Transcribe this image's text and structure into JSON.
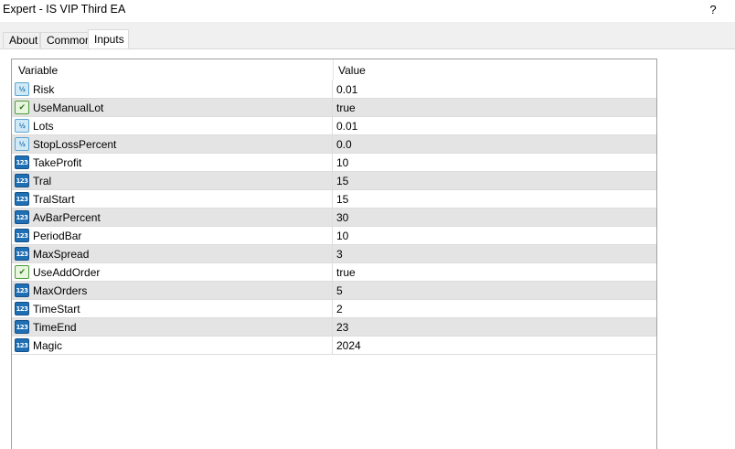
{
  "window": {
    "title": "Expert - IS VIP Third EA",
    "help_label": "?"
  },
  "tabs": [
    {
      "label": "About"
    },
    {
      "label": "Common"
    },
    {
      "label": "Inputs"
    }
  ],
  "grid": {
    "columns": [
      "Variable",
      "Value"
    ],
    "rows": [
      {
        "variable": "Risk",
        "value": "0.01",
        "icon": "double-type-icon"
      },
      {
        "variable": "UseManualLot",
        "value": "true",
        "icon": "bool-type-icon"
      },
      {
        "variable": "Lots",
        "value": "0.01",
        "icon": "double-type-icon"
      },
      {
        "variable": "StopLossPercent",
        "value": "0.0",
        "icon": "double-type-icon"
      },
      {
        "variable": "TakeProfit",
        "value": "10",
        "icon": "int-type-icon"
      },
      {
        "variable": "Tral",
        "value": "15",
        "icon": "int-type-icon"
      },
      {
        "variable": "TralStart",
        "value": "15",
        "icon": "int-type-icon"
      },
      {
        "variable": "AvBarPercent",
        "value": "30",
        "icon": "int-type-icon"
      },
      {
        "variable": "PeriodBar",
        "value": "10",
        "icon": "int-type-icon"
      },
      {
        "variable": "MaxSpread",
        "value": "3",
        "icon": "int-type-icon"
      },
      {
        "variable": "UseAddOrder",
        "value": "true",
        "icon": "bool-type-icon"
      },
      {
        "variable": "MaxOrders",
        "value": "5",
        "icon": "int-type-icon"
      },
      {
        "variable": "TimeStart",
        "value": "2",
        "icon": "int-type-icon"
      },
      {
        "variable": "TimeEnd",
        "value": "23",
        "icon": "int-type-icon"
      },
      {
        "variable": "Magic",
        "value": "2024",
        "icon": "int-type-icon"
      }
    ]
  }
}
